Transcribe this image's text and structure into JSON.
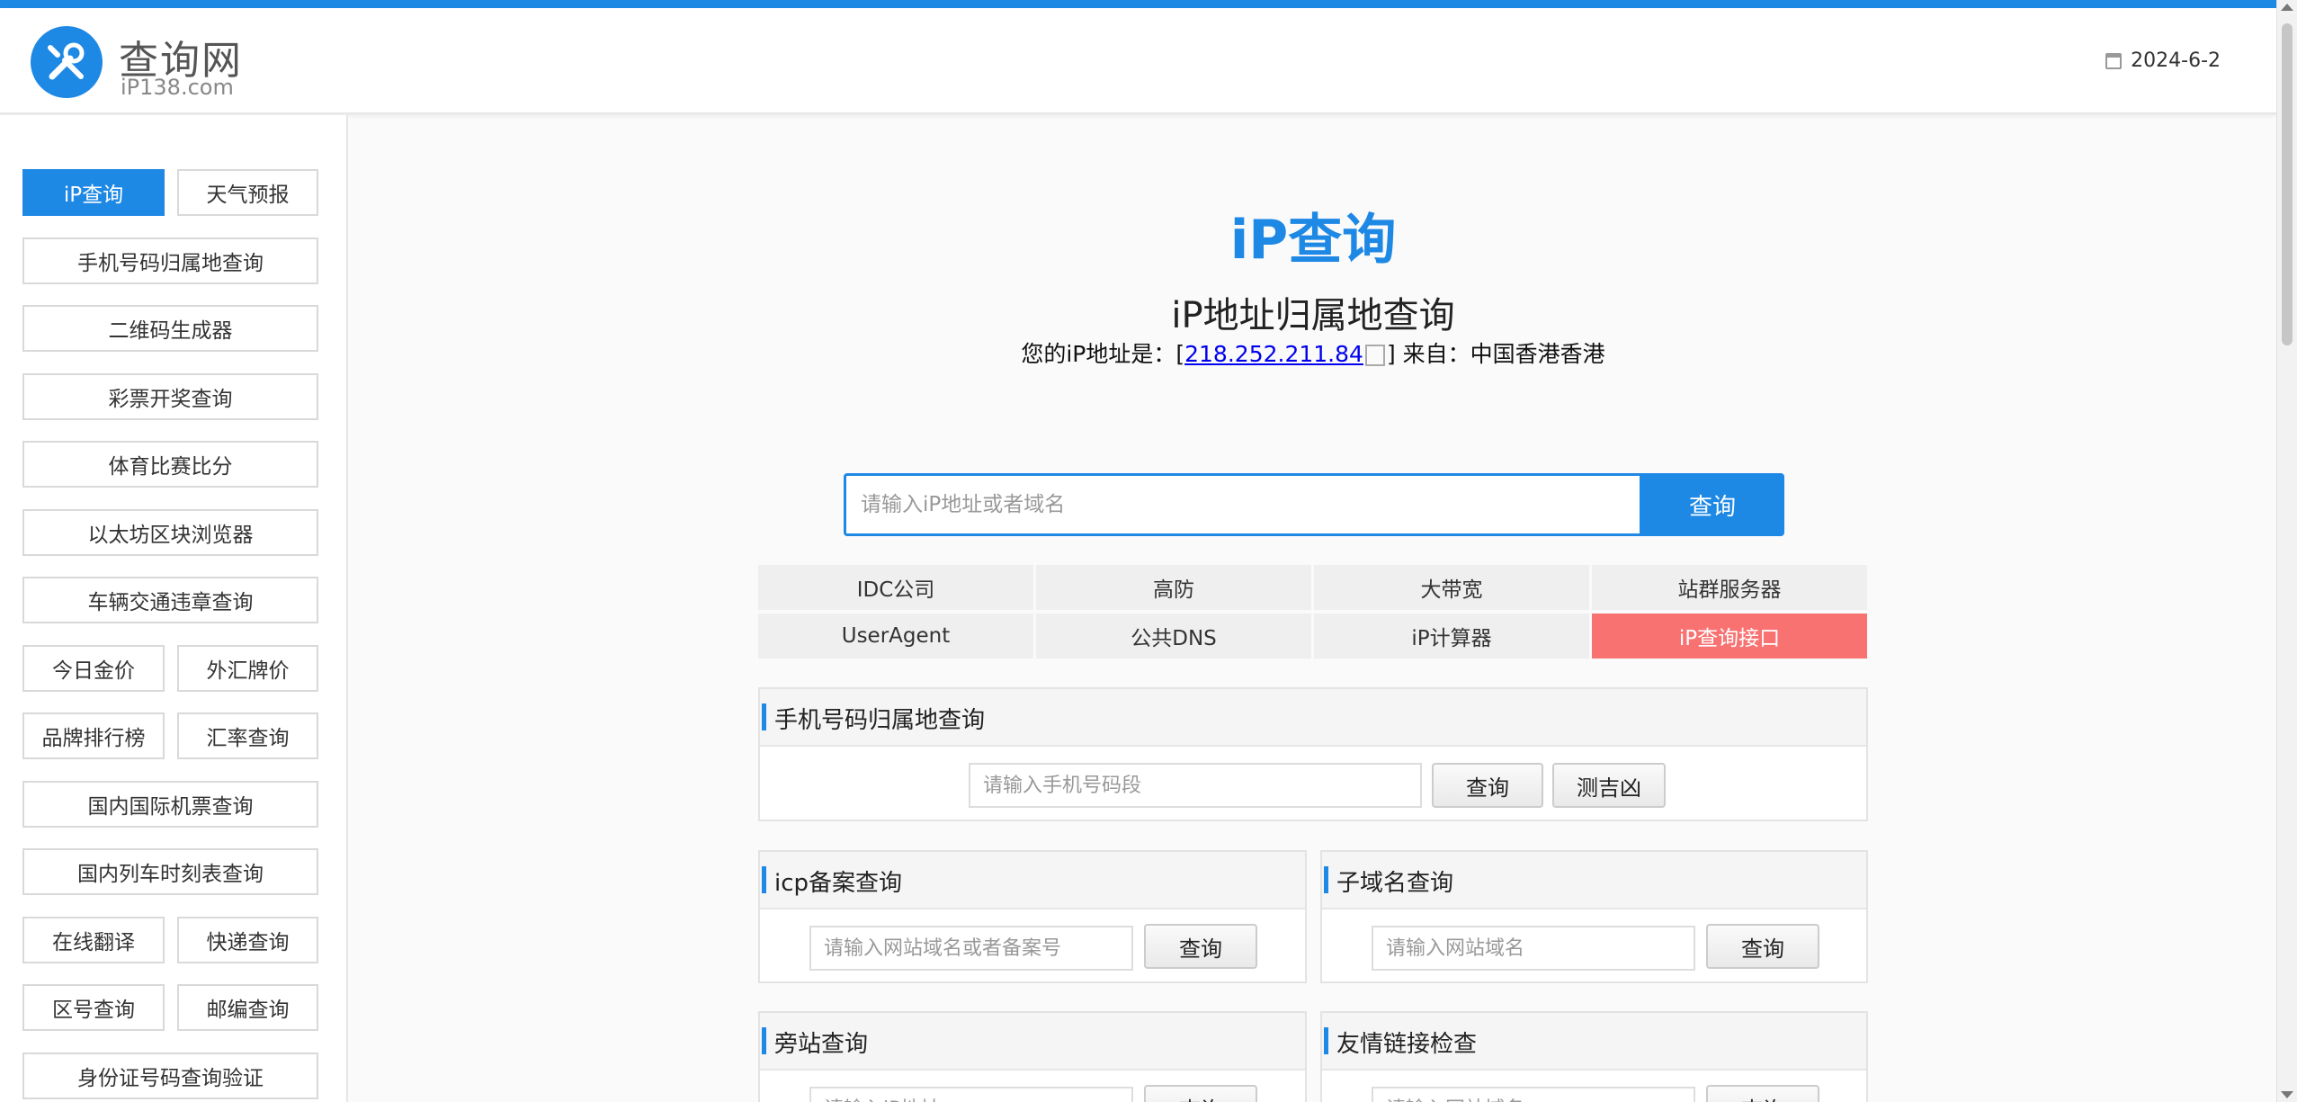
{
  "header": {
    "logo_title": "查询网",
    "logo_sub": "iP138.com",
    "date": "2024-6-2"
  },
  "sidebar": {
    "items": [
      {
        "label": "iP查询",
        "active": true
      },
      {
        "label": "天气预报"
      },
      {
        "label": "手机号码归属地查询"
      },
      {
        "label": "二维码生成器"
      },
      {
        "label": "彩票开奖查询"
      },
      {
        "label": "体育比赛比分"
      },
      {
        "label": "以太坊区块浏览器"
      },
      {
        "label": "车辆交通违章查询"
      },
      {
        "label": "今日金价"
      },
      {
        "label": "外汇牌价"
      },
      {
        "label": "品牌排行榜"
      },
      {
        "label": "汇率查询"
      },
      {
        "label": "国内国际机票查询"
      },
      {
        "label": "国内列车时刻表查询"
      },
      {
        "label": "在线翻译"
      },
      {
        "label": "快递查询"
      },
      {
        "label": "区号查询"
      },
      {
        "label": "邮编查询"
      },
      {
        "label": "身份证号码查询验证"
      }
    ]
  },
  "main": {
    "title": "iP查询",
    "subtitle": "iP地址归属地查询",
    "ip_prefix": "您的iP地址是：[",
    "ip_address": "218.252.211.84",
    "ip_suffix": "] 来自：中国香港香港",
    "search_placeholder": "请输入iP地址或者域名",
    "search_button": "查询"
  },
  "quick_links": [
    {
      "label": "IDC公司"
    },
    {
      "label": "高防"
    },
    {
      "label": "大带宽"
    },
    {
      "label": "站群服务器"
    },
    {
      "label": "UserAgent"
    },
    {
      "label": "公共DNS"
    },
    {
      "label": "iP计算器"
    },
    {
      "label": "iP查询接口",
      "highlight": true
    }
  ],
  "panels": {
    "phone": {
      "title": "手机号码归属地查询",
      "placeholder": "请输入手机号码段",
      "query_button": "查询",
      "fortune_button": "测吉凶"
    },
    "icp": {
      "title": "icp备案查询",
      "placeholder": "请输入网站域名或者备案号",
      "query_button": "查询"
    },
    "subdomain": {
      "title": "子域名查询",
      "placeholder": "请输入网站域名",
      "query_button": "查询"
    },
    "sidesite": {
      "title": "旁站查询",
      "placeholder": "请输入iP地址",
      "query_button": "查询"
    },
    "friendlink": {
      "title": "友情链接检查",
      "placeholder": "请输入网站域名",
      "query_button": "查询"
    }
  },
  "colors": {
    "accent": "#1e88e5",
    "highlight": "#f97272"
  }
}
